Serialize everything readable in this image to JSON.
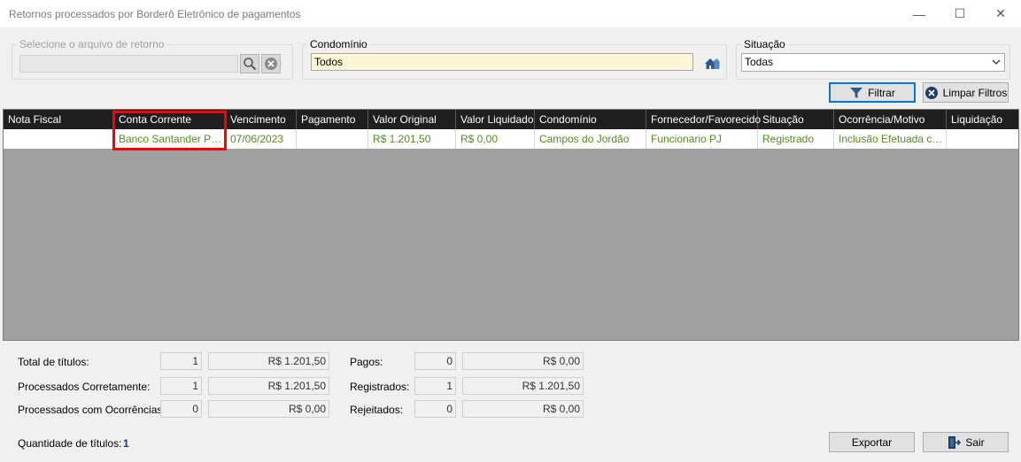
{
  "window": {
    "title": "Retornos processados por Borderô Eletrônico de pagamentos",
    "minimize_glyph": "—",
    "maximize_glyph": "☐",
    "close_glyph": "✕"
  },
  "filters": {
    "file": {
      "legend": "Selecione o arquivo de retorno",
      "value": "",
      "search_icon": "magnifier-icon",
      "clear_icon": "clear-x-icon"
    },
    "condominio": {
      "legend": "Condomínio",
      "value": "Todos",
      "icon": "buildings-icon"
    },
    "situacao": {
      "legend": "Situação",
      "selected": "Todas"
    },
    "filter_button": "Filtrar",
    "clear_button": "Limpar Filtros"
  },
  "table": {
    "columns": [
      "Nota Fiscal",
      "Conta Corrente",
      "Vencimento",
      "Pagamento",
      "Valor Original",
      "Valor Liquidado",
      "Condomínio",
      "Fornecedor/Favorecido",
      "Situação",
      "Ocorrência/Motivo",
      "Liquidação"
    ],
    "rows": [
      [
        "",
        "Banco Santander Prin…",
        "07/06/2023",
        "",
        "R$ 1.201,50",
        "R$ 0,00",
        "Campos do Jordão",
        "Funcionario PJ",
        "Registrado",
        "Inclusão Efetuada co…",
        ""
      ]
    ]
  },
  "totals": {
    "total_titulos": {
      "label": "Total de títulos:",
      "count": "1",
      "value": "R$ 1.201,50"
    },
    "processados_corretamente": {
      "label": "Processados Corretamente:",
      "count": "1",
      "value": "R$ 1.201,50"
    },
    "processados_ocorrencias": {
      "label": "Processados com Ocorrências:",
      "count": "0",
      "value": "R$ 0,00"
    },
    "pagos": {
      "label": "Pagos:",
      "count": "0",
      "value": "R$ 0,00"
    },
    "registrados": {
      "label": "Registrados:",
      "count": "1",
      "value": "R$ 1.201,50"
    },
    "rejeitados": {
      "label": "Rejeitados:",
      "count": "0",
      "value": "R$ 0,00"
    }
  },
  "footer": {
    "quantidade_label": "Quantidade de títulos:",
    "quantidade_value": "1",
    "export_button": "Exportar",
    "exit_button": "Sair"
  },
  "colors": {
    "row_text": "#4f8f1b",
    "header_bg": "#1f1f1f",
    "highlight": "#ff0000",
    "condominio_bg": "#fff6d5",
    "accent": "#0078d7"
  }
}
